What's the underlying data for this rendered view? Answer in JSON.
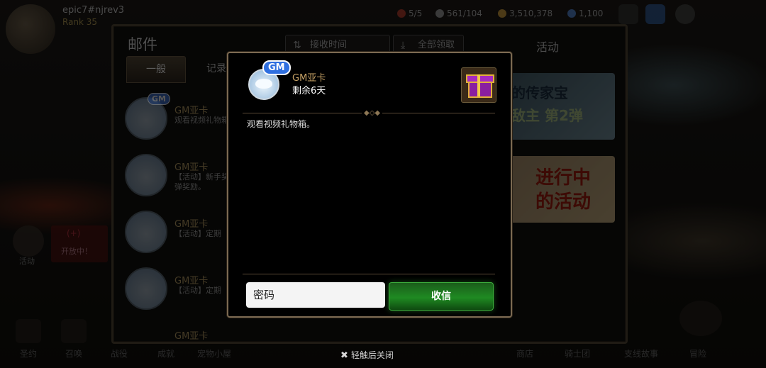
{
  "player": {
    "name": "epic7#njrev3",
    "rank": "Rank 35"
  },
  "resources": {
    "stamina": "5/5",
    "energy": "561/104",
    "gold": "3,510,378",
    "gems": "1,100"
  },
  "mail": {
    "title": "邮件",
    "tabs": [
      {
        "label": "一般"
      },
      {
        "label": "记录"
      }
    ],
    "sort_label": "接收时间",
    "claim_all_label": "全部领取",
    "activity_title": "活动",
    "items": [
      {
        "badge": "GM",
        "sender": "GM亚卡",
        "preview": "观看视频礼物箱"
      },
      {
        "badge": "",
        "sender": "GM亚卡",
        "preview": "【活动】新手奖\n弹奖励。"
      },
      {
        "badge": "",
        "sender": "GM亚卡",
        "preview": "【活动】定期"
      },
      {
        "badge": "",
        "sender": "GM亚卡",
        "preview": "【活动】定期"
      },
      {
        "badge": "",
        "sender": "GM亚卡",
        "preview": ""
      }
    ],
    "banners": [
      {
        "line1": "的传家宝",
        "line2": "敌主 第2弹"
      },
      {
        "text": "进行中\n的活动"
      }
    ]
  },
  "side": {
    "activity_label": "活动",
    "red_title": "(+)",
    "red_sub": "开放中！"
  },
  "bottom_bar": {
    "items": [
      {
        "label": "圣约"
      },
      {
        "label": "召唤"
      },
      {
        "label": "战役"
      },
      {
        "label": "成就"
      },
      {
        "label": "宠物小屋"
      },
      {
        "label": "商店"
      },
      {
        "label": "骑士团"
      },
      {
        "label": "支线故事"
      },
      {
        "label": "冒险"
      }
    ]
  },
  "modal": {
    "badge": "GM",
    "sender": "GM亚卡",
    "expiry": "剩余6天",
    "body": "观看视频礼物箱。",
    "input_placeholder": "密码",
    "receive_label": "收信",
    "gift_icon": "gift-box-icon"
  },
  "close_hint": "轻触后关闭",
  "colors": {
    "accent_gold": "#c8a366",
    "button_green": "#1f8a22",
    "frame_brown": "#7c6a52"
  }
}
